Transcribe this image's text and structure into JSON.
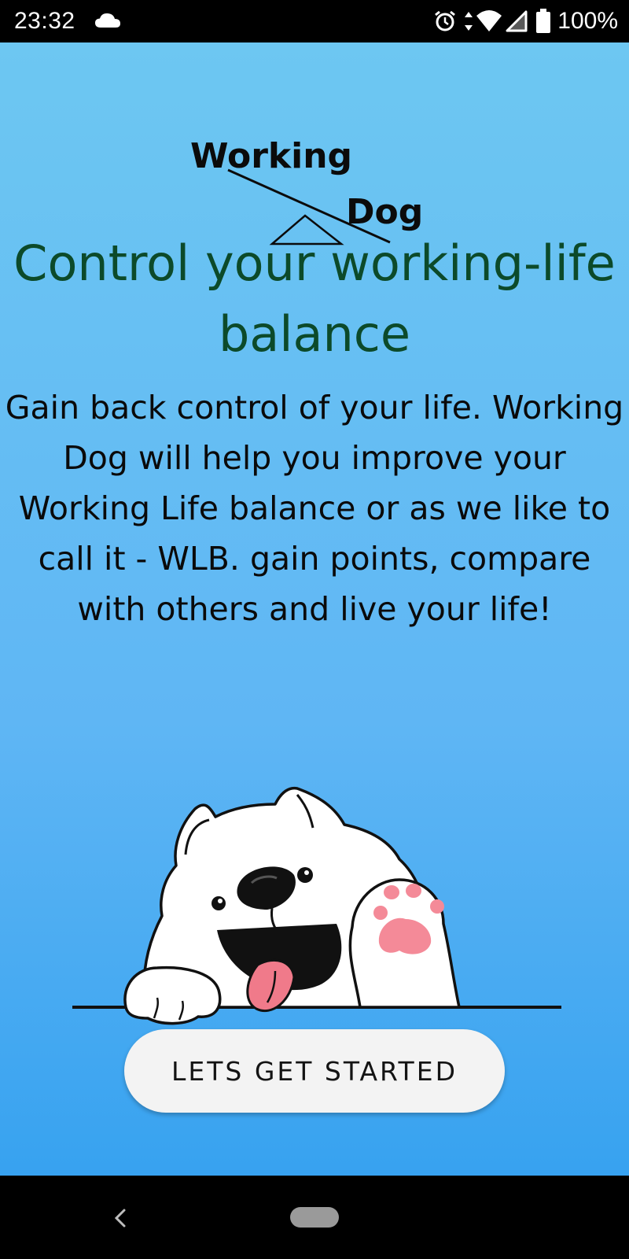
{
  "status_bar": {
    "time": "23:32",
    "battery": "100%",
    "icons": [
      "cloud-icon",
      "alarm-icon",
      "data-arrows-icon",
      "wifi-icon",
      "cell-signal-icon",
      "battery-icon"
    ]
  },
  "logo": {
    "word1": "Working",
    "word2": "Dog"
  },
  "headline": "Control your working-life balance",
  "body": "Gain back control of your life. Working Dog will help you improve your Working Life balance or as we like to call it - WLB. gain points, compare with others and live your life!",
  "illustration": {
    "icon": "waving-dog-icon"
  },
  "cta": {
    "label": "LETS GET STARTED"
  },
  "nav_bar": {
    "icons": [
      "back-icon",
      "home-pill-icon"
    ]
  },
  "colors": {
    "gradient_top": "#6dc7f2",
    "gradient_bottom": "#37a2f0",
    "headline": "#0c4a2a",
    "button_bg": "#f3f3f3",
    "paw_pink": "#f48a98",
    "tongue": "#f07a8a"
  }
}
